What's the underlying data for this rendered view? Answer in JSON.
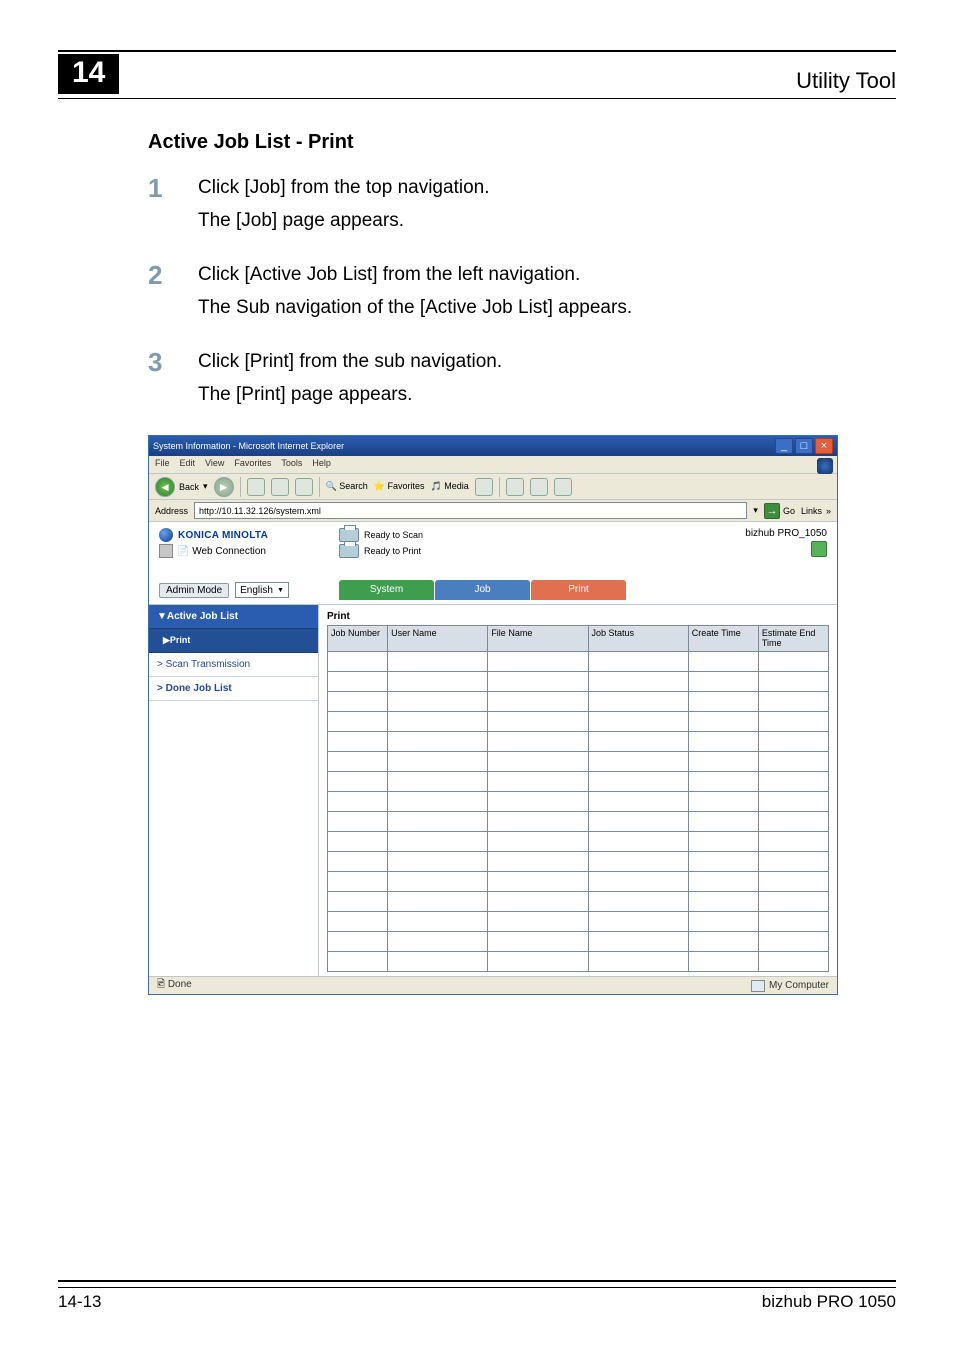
{
  "chapter_number": "14",
  "header_title": "Utility Tool",
  "section_title": "Active Job List - Print",
  "steps": [
    {
      "num": "1",
      "line1": "Click [Job] from the top navigation.",
      "line2": "The [Job] page appears."
    },
    {
      "num": "2",
      "line1": "Click [Active Job List] from the left navigation.",
      "line2": "The Sub navigation of the [Active Job List] appears."
    },
    {
      "num": "3",
      "line1": "Click [Print] from the sub navigation.",
      "line2": "The [Print] page appears."
    }
  ],
  "footer_left": "14-13",
  "footer_right": "bizhub PRO 1050",
  "screenshot": {
    "window_title": "System Information - Microsoft Internet Explorer",
    "menus": [
      "File",
      "Edit",
      "View",
      "Favorites",
      "Tools",
      "Help"
    ],
    "toolbar": {
      "back": "Back",
      "search": "Search",
      "favorites": "Favorites",
      "media": "Media"
    },
    "address_label": "Address",
    "address_value": "http://10.11.32.126/system.xml",
    "go_label": "Go",
    "links_label": "Links",
    "brand": "KONICA MINOLTA",
    "app_name": "Web Connection",
    "status_scan": "Ready to Scan",
    "status_print": "Ready to Print",
    "device_name": "bizhub PRO_1050",
    "admin_mode_btn": "Admin Mode",
    "language": "English",
    "tabs": {
      "system": "System",
      "job": "Job",
      "print": "Print"
    },
    "leftnav": {
      "active_job_list": "▼Active Job List",
      "print": "▶Print",
      "scan_tx": "> Scan Transmission",
      "done_job_list": "> Done Job List"
    },
    "table_title": "Print",
    "columns": [
      "Job Number",
      "User Name",
      "File Name",
      "Job Status",
      "Create Time",
      "Estimate End Time"
    ],
    "status_done": "Done",
    "status_mycomputer": "My Computer"
  }
}
